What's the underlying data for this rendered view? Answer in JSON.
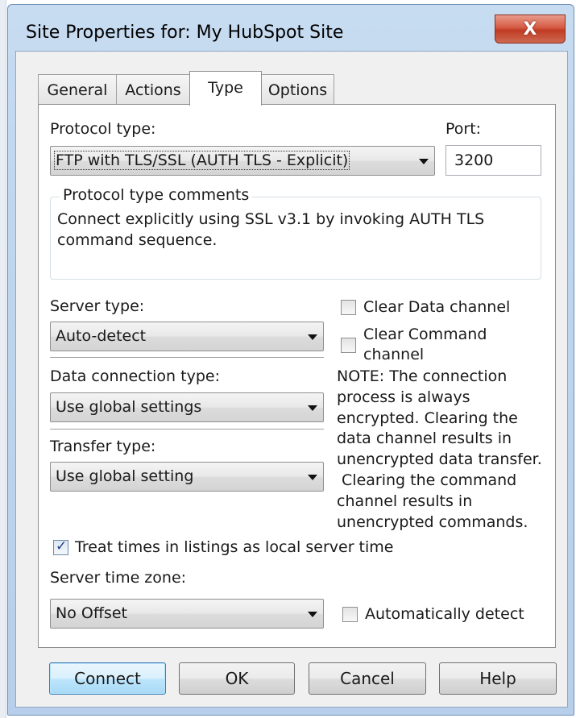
{
  "window": {
    "title": "Site Properties for: My HubSpot Site",
    "close_glyph": "X"
  },
  "tabs": [
    {
      "label": "General",
      "active": false
    },
    {
      "label": "Actions",
      "active": false
    },
    {
      "label": "Type",
      "active": true
    },
    {
      "label": "Options",
      "active": false
    }
  ],
  "protocol": {
    "label": "Protocol type:",
    "value": "FTP with TLS/SSL (AUTH TLS - Explicit)"
  },
  "port": {
    "label": "Port:",
    "value": "3200"
  },
  "comments": {
    "caption": "Protocol type comments",
    "line1": "Connect explicitly using SSL v3.1 by invoking AUTH TLS",
    "line2": "command sequence."
  },
  "server_type": {
    "label": "Server type:",
    "value": "Auto-detect"
  },
  "data_connection": {
    "label": "Data connection type:",
    "value": "Use global settings"
  },
  "transfer_type": {
    "label": "Transfer type:",
    "value": "Use global setting"
  },
  "clear_data": {
    "label": "Clear Data channel",
    "checked": false
  },
  "clear_command": {
    "label_line1": "Clear Command",
    "label_line2": "channel",
    "checked": false
  },
  "note": {
    "lines": [
      "NOTE: The connection",
      "process is always",
      "encrypted.  Clearing the",
      "data channel results in",
      "unencrypted data transfer.",
      " Clearing the command",
      "channel results in",
      "unencrypted commands."
    ]
  },
  "treat_times": {
    "label": "Treat times in listings as local server time",
    "checked": true
  },
  "time_zone": {
    "label": "Server time zone:",
    "value": "No Offset"
  },
  "auto_detect": {
    "label": "Automatically detect",
    "checked": false
  },
  "buttons": {
    "connect": "Connect",
    "ok": "OK",
    "cancel": "Cancel",
    "help": "Help"
  },
  "icons": {
    "check": "✓"
  },
  "colors": {
    "title_bar": "#bfd6ee",
    "close_button": "#c13b23",
    "default_button": "#a7d9f5"
  }
}
